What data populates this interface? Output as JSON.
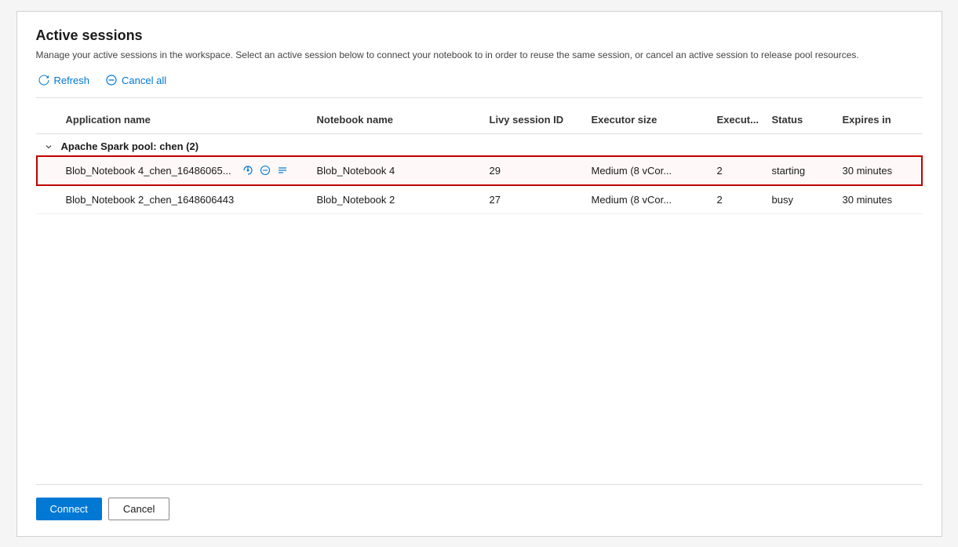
{
  "dialog": {
    "title": "Active sessions",
    "subtitle": "Manage your active sessions in the workspace. Select an active session below to connect your notebook to in order to reuse the same session, or cancel an active session to release pool resources.",
    "toolbar": {
      "refresh_label": "Refresh",
      "cancel_all_label": "Cancel all"
    },
    "table": {
      "columns": [
        {
          "key": "expand",
          "label": ""
        },
        {
          "key": "app_name",
          "label": "Application name"
        },
        {
          "key": "notebook_name",
          "label": "Notebook name"
        },
        {
          "key": "livy_session_id",
          "label": "Livy session ID"
        },
        {
          "key": "executor_size",
          "label": "Executor size"
        },
        {
          "key": "execut",
          "label": "Execut..."
        },
        {
          "key": "status",
          "label": "Status"
        },
        {
          "key": "expires_in",
          "label": "Expires in"
        }
      ],
      "group": {
        "label": "Apache Spark pool: chen (2)"
      },
      "rows": [
        {
          "app_name": "Blob_Notebook 4_chen_16486065...",
          "notebook_name": "Blob_Notebook 4",
          "livy_session_id": "29",
          "executor_size": "Medium (8 vCor...",
          "execut": "2",
          "status": "starting",
          "expires_in": "30 minutes",
          "selected": true
        },
        {
          "app_name": "Blob_Notebook 2_chen_1648606443",
          "notebook_name": "Blob_Notebook 2",
          "livy_session_id": "27",
          "executor_size": "Medium (8 vCor...",
          "execut": "2",
          "status": "busy",
          "expires_in": "30 minutes",
          "selected": false
        }
      ]
    },
    "footer": {
      "connect_label": "Connect",
      "cancel_label": "Cancel"
    }
  }
}
